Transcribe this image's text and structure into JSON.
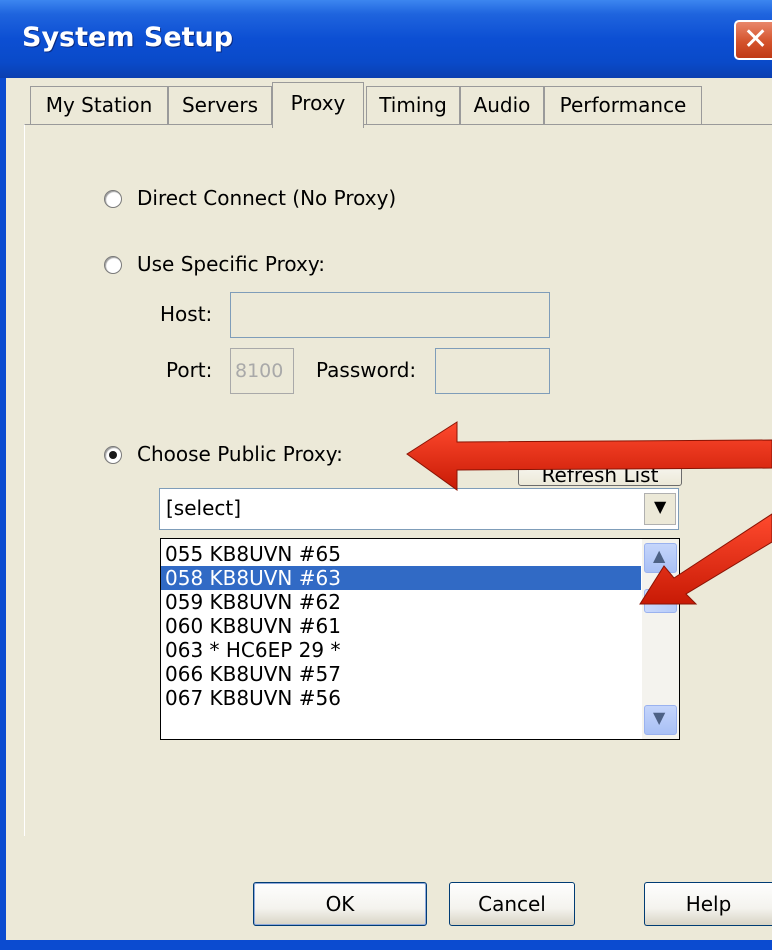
{
  "window": {
    "title": "System Setup"
  },
  "tabs": [
    {
      "label": "My Station"
    },
    {
      "label": "Servers"
    },
    {
      "label": "Proxy"
    },
    {
      "label": "Timing"
    },
    {
      "label": "Audio"
    },
    {
      "label": "Performance"
    }
  ],
  "active_tab": "Proxy",
  "proxy": {
    "direct_label": "Direct Connect (No Proxy)",
    "specific_label": "Use Specific Proxy:",
    "host_label": "Host:",
    "host_value": "",
    "port_label": "Port:",
    "port_value": "8100",
    "password_label": "Password:",
    "password_value": "",
    "public_label": "Choose Public Proxy:",
    "selected_option": "public",
    "refresh_label": "Refresh List",
    "combo_value": "[select]",
    "list": [
      "055 KB8UVN #65",
      "058 KB8UVN #63",
      "059 KB8UVN #62",
      "060 KB8UVN #61",
      "063 * HC6EP 29 *",
      "066 KB8UVN #57",
      "067 KB8UVN #56"
    ],
    "highlighted_item": "058 KB8UVN #63"
  },
  "buttons": {
    "ok": "OK",
    "cancel": "Cancel",
    "help": "Help"
  },
  "colors": {
    "title_bar": "#0a4ac9",
    "selection": "#316ac5",
    "annotation_arrow": "#e8250f",
    "dialog_bg": "#ece9d8"
  },
  "icons": {
    "close": "close-icon",
    "dropdown": "chevron-down-icon",
    "scroll_up": "chevron-up-icon",
    "scroll_down": "chevron-down-icon"
  }
}
